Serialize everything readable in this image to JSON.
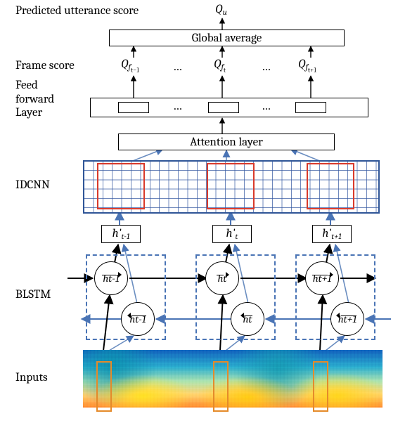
{
  "top": {
    "predicted_label": "Predicted utterance score",
    "Qu": "Q",
    "Qu_sub": "u",
    "global_avg": "Global average"
  },
  "frame": {
    "label": "Frame score",
    "Q_sym": "Q",
    "f_sub_left": "f_{t-1}",
    "f_sub_mid": "f_t",
    "f_sub_right": "f_{t+1}",
    "ell": "…",
    "ell2": "…"
  },
  "ff": {
    "label_line1": "Feed",
    "label_line2": "forward",
    "label_line3": "Layer",
    "ell": "…",
    "ell2": "…"
  },
  "attn": {
    "label": "Attention layer"
  },
  "idcnn": {
    "label": "IDCNN"
  },
  "hprime": {
    "left": "h'",
    "left_sub": "t-1",
    "mid": "h'",
    "mid_sub": "t",
    "right": "h'",
    "right_sub": "t+1"
  },
  "blstm": {
    "label": "BLSTM",
    "hf_left": "h",
    "hf_left_sub": "t-1",
    "hf_mid": "h",
    "hf_mid_sub": "t",
    "hf_right": "h",
    "hf_right_sub": "t+1",
    "hb_left": "h",
    "hb_left_sub": "t-1",
    "hb_mid": "h",
    "hb_mid_sub": "t",
    "hb_right": "h",
    "hb_right_sub": "t+1"
  },
  "inputs": {
    "label": "Inputs"
  }
}
